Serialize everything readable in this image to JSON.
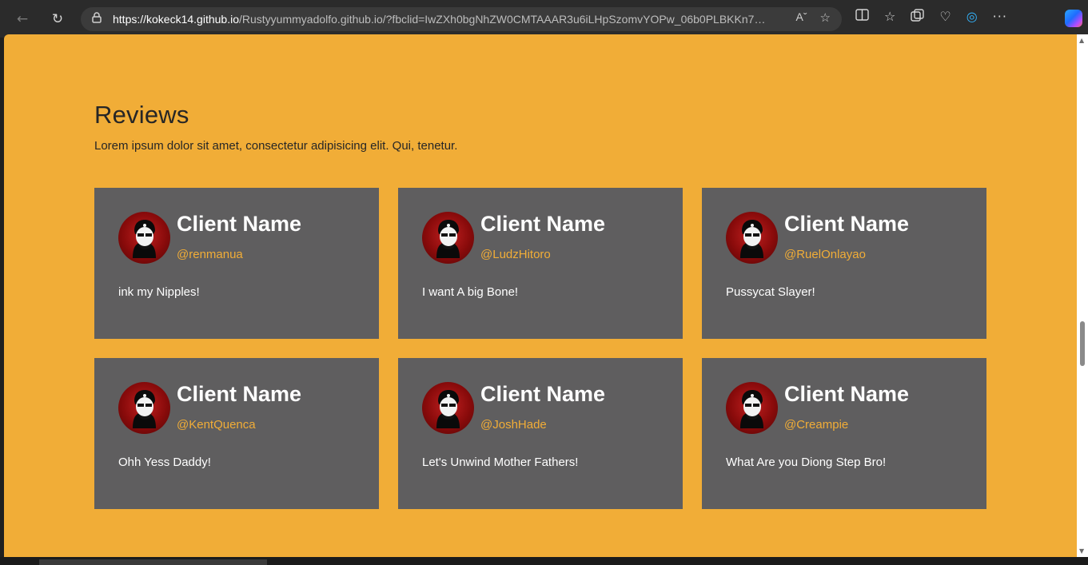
{
  "browser": {
    "url_host": "https://kokeck14.github.io",
    "url_path": "/Rustyyummyadolfo.github.io/?fbclid=IwZXh0bgNhZW0CMTAAAR3u6iLHpSzomvYOPw_06b0PLBKKn7k5...",
    "nav_icons": [
      "back-arrow-icon",
      "refresh-icon",
      "lock-icon"
    ],
    "address_icons": [
      "read-aloud-icon",
      "favorite-star-icon"
    ],
    "toolbar_icons": [
      "split-screen-icon",
      "favorites-icon",
      "collections-icon",
      "health-icon",
      "edge-icon",
      "more-icon",
      "copilot-icon"
    ]
  },
  "colors": {
    "page_background": "#f1ad37",
    "card_background": "#5f5e5f",
    "handle_color": "#f1ad37",
    "chrome_background": "#2b2b2b"
  },
  "reviews": {
    "title": "Reviews",
    "subtitle": "Lorem ipsum dolor sit amet, consectetur adipisicing elit. Qui, tenetur.",
    "cards": [
      {
        "name": "Client Name",
        "handle": "@renmanua",
        "text": "ink my Nipples!"
      },
      {
        "name": "Client Name",
        "handle": "@LudzHitoro",
        "text": "I want A big Bone!"
      },
      {
        "name": "Client Name",
        "handle": "@RuelOnlayao",
        "text": "Pussycat Slayer!"
      },
      {
        "name": "Client Name",
        "handle": "@KentQuenca",
        "text": "Ohh Yess Daddy!"
      },
      {
        "name": "Client Name",
        "handle": "@JoshHade",
        "text": "Let's Unwind Mother Fathers!"
      },
      {
        "name": "Client Name",
        "handle": "@Creampie",
        "text": "What Are you Diong Step Bro!"
      }
    ]
  }
}
